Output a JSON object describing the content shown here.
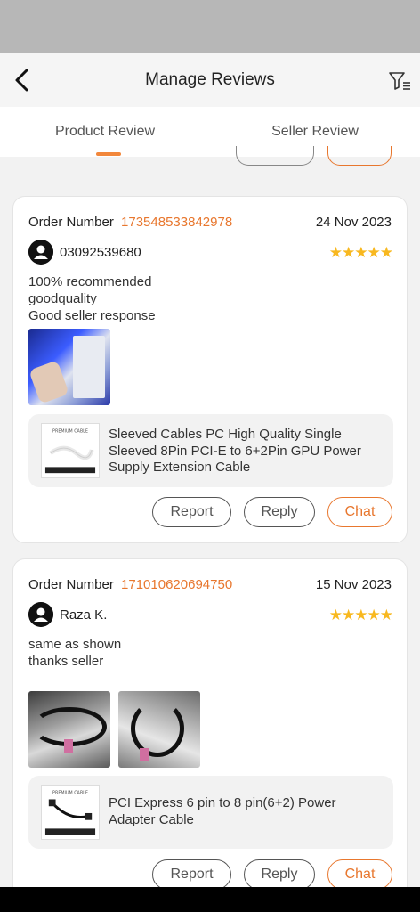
{
  "header": {
    "title": "Manage Reviews"
  },
  "tabs": [
    {
      "label": "Product Review"
    },
    {
      "label": "Seller Review"
    }
  ],
  "reviews": [
    {
      "order_label": "Order Number",
      "order_number": "173548533842978",
      "date": "24 Nov 2023",
      "user": "03092539680",
      "rating": 5,
      "stars": "★★★★★",
      "text_lines": [
        "100% recommended",
        "goodquality",
        "Good seller response"
      ],
      "product_title": "Sleeved Cables PC High Quality Single Sleeved 8Pin PCI-E to 6+2Pin GPU Power Supply Extension Cable",
      "actions": {
        "report": "Report",
        "reply": "Reply",
        "chat": "Chat"
      }
    },
    {
      "order_label": "Order Number",
      "order_number": "171010620694750",
      "date": "15 Nov 2023",
      "user": "Raza K.",
      "rating": 5,
      "stars": "★★★★★",
      "text_lines": [
        "same as shown",
        "thanks seller"
      ],
      "product_title": "PCI Express 6 pin to 8 pin(6+2) Power Adapter Cable",
      "actions": {
        "report": "Report",
        "reply": "Reply",
        "chat": "Chat"
      }
    }
  ],
  "colors": {
    "accent": "#e8772e",
    "star": "#f8b81f"
  }
}
